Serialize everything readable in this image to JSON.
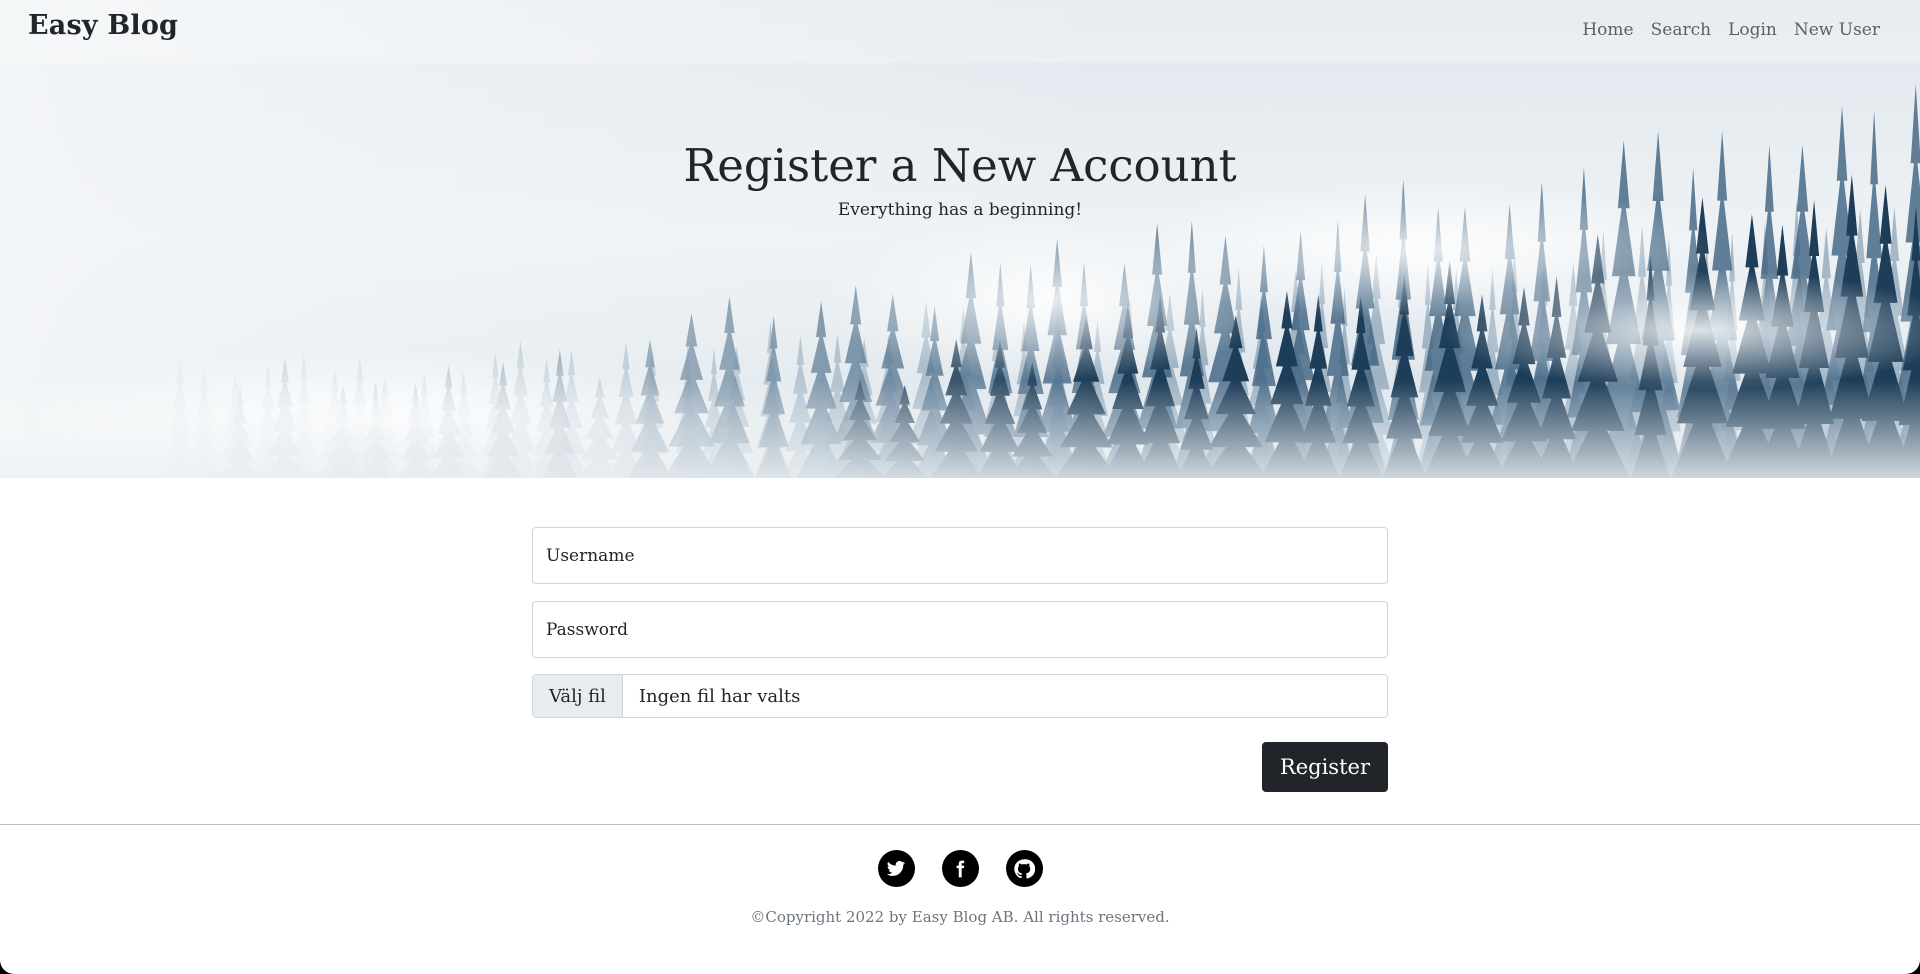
{
  "nav": {
    "brand": "Easy Blog",
    "links": [
      "Home",
      "Search",
      "Login",
      "New User"
    ]
  },
  "hero": {
    "title": "Register a New Account",
    "subtitle": "Everything has a beginning!"
  },
  "form": {
    "username_placeholder": "Username",
    "password_placeholder": "Password",
    "file_button": "Välj fil",
    "file_status": "Ingen fil har valts",
    "submit_label": "Register"
  },
  "footer": {
    "socials": [
      "twitter-icon",
      "facebook-icon",
      "github-icon"
    ],
    "copyright": "©Copyright 2022 by Easy Blog AB. All rights reserved."
  },
  "colors": {
    "primary_button": "#212529",
    "nav_link": "#5a6068",
    "muted_text": "#6c757d"
  }
}
